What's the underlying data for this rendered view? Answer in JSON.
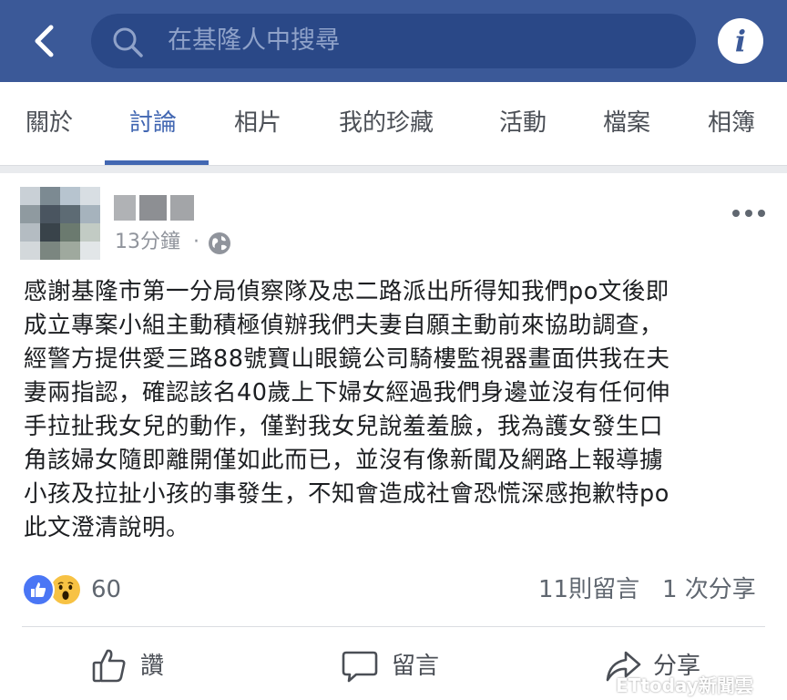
{
  "search": {
    "placeholder": "在基隆人中搜尋"
  },
  "tabs": [
    {
      "label": "關於"
    },
    {
      "label": "討論"
    },
    {
      "label": "相片"
    },
    {
      "label": "我的珍藏"
    },
    {
      "label": "活動"
    },
    {
      "label": "檔案"
    },
    {
      "label": "相簿"
    }
  ],
  "post": {
    "time": "13分鐘",
    "separator": "·",
    "text": "感謝基隆市第一分局偵察隊及忠二路派出所得知我們po文後即\n成立專案小組主動積極偵辦我們夫妻自願主動前來協助調查，\n經警方提供愛三路88號寶山眼鏡公司騎樓監視器畫面供我在夫\n妻兩指認，確認該名40歲上下婦女經過我們身邊並沒有任何伸\n手拉扯我女兒的動作，僅對我女兒說羞羞臉，我為護女發生口\n角該婦女隨即離開僅如此而已，並沒有像新聞及網路上報導擄\n小孩及拉扯小孩的事發生，不知會造成社會恐慌深感抱歉特po\n此文澄清說明。",
    "reaction_count": "60",
    "comment_count": "11則留言",
    "share_count": "1 次分享"
  },
  "actions": {
    "like": "讚",
    "comment": "留言",
    "share": "分享"
  },
  "watermark": "ETtoday新聞雲",
  "colors": {
    "header": "#3b5998",
    "accent": "#4267b2",
    "text": "#1c1e21",
    "muted": "#606770"
  }
}
